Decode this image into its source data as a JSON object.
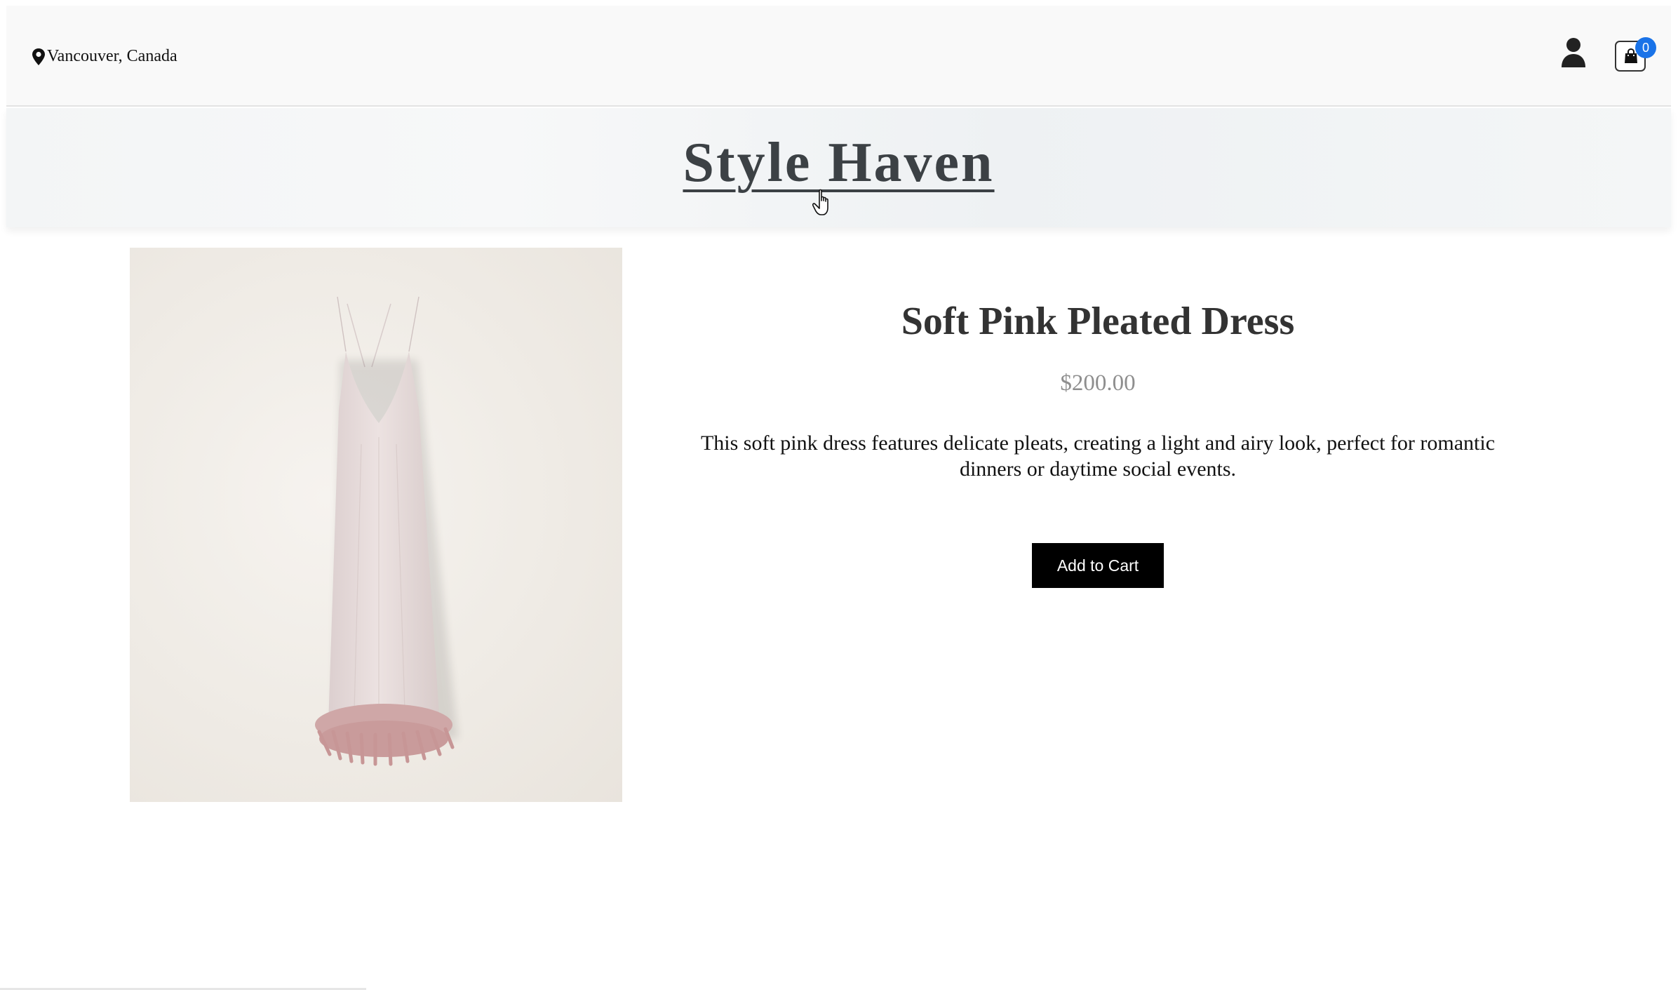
{
  "header": {
    "location": "Vancouver, Canada",
    "location_icon": "map-pin-icon",
    "user_icon": "user-icon",
    "cart_icon": "shopping-bag-icon",
    "cart_count": "0",
    "badge_color": "#1a73e8"
  },
  "brand": {
    "title": "Style Haven"
  },
  "product": {
    "title": "Soft Pink Pleated Dress",
    "price": "$200.00",
    "description": "This soft pink dress features delicate pleats, creating a light and airy look, perfect for romantic dinners or daytime social events.",
    "add_to_cart_label": "Add to Cart",
    "image_alt": "Pink slip dress with feather hem"
  }
}
